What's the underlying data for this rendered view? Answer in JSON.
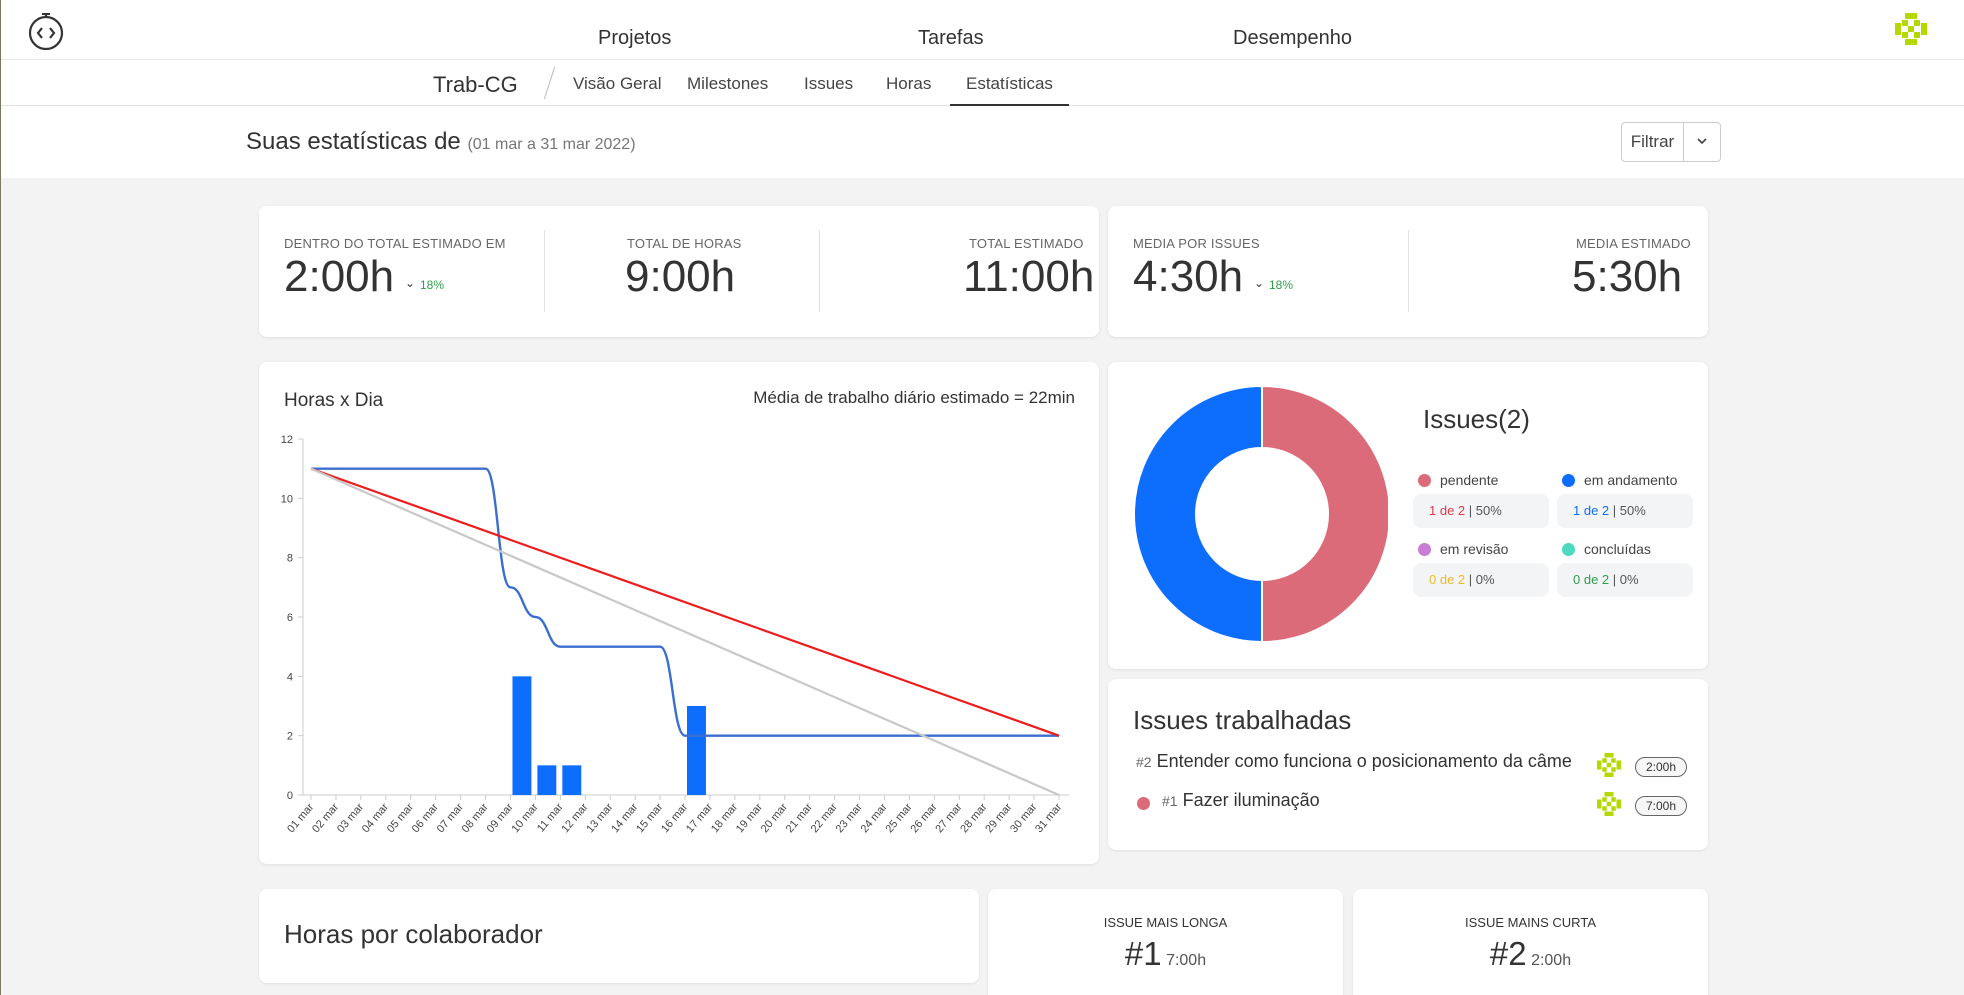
{
  "nav": {
    "items": [
      "Projetos",
      "Tarefas",
      "Desempenho"
    ]
  },
  "project": {
    "name": "Trab-CG",
    "tabs": [
      "Visão Geral",
      "Milestones",
      "Issues",
      "Horas",
      "Estatísticas"
    ],
    "active_tab": "Estatísticas"
  },
  "header": {
    "title": "Suas estatísticas de",
    "range": "(01 mar a 31 mar 2022)",
    "filter_label": "Filtrar"
  },
  "metrics": [
    {
      "label": "DENTRO DO TOTAL ESTIMADO EM",
      "value": "2:00h",
      "delta": "18%"
    },
    {
      "label": "TOTAL DE HORAS",
      "value": "9:00h"
    },
    {
      "label": "TOTAL ESTIMADO",
      "value": "11:00h"
    },
    {
      "label": "MEDIA POR ISSUES",
      "value": "4:30h",
      "delta": "18%"
    },
    {
      "label": "MEDIA ESTIMADO",
      "value": "5:30h"
    }
  ],
  "hours_chart": {
    "title": "Horas x Dia",
    "note": "Média de trabalho diário estimado = 22min"
  },
  "chart_data": [
    {
      "type": "bar",
      "title": "Horas x Dia",
      "categories": [
        "01 mar",
        "02 mar",
        "03 mar",
        "04 mar",
        "05 mar",
        "06 mar",
        "07 mar",
        "08 mar",
        "09 mar",
        "10 mar",
        "11 mar",
        "12 mar",
        "13 mar",
        "14 mar",
        "15 mar",
        "16 mar",
        "17 mar",
        "18 mar",
        "19 mar",
        "20 mar",
        "21 mar",
        "22 mar",
        "23 mar",
        "24 mar",
        "25 mar",
        "26 mar",
        "27 mar",
        "28 mar",
        "29 mar",
        "30 mar",
        "31 mar"
      ],
      "ylim": [
        0,
        12
      ],
      "yticks": [
        0,
        2,
        4,
        6,
        8,
        10,
        12
      ],
      "series": [
        {
          "kind": "bar",
          "color": "#0d6efd",
          "values": [
            0,
            0,
            0,
            0,
            0,
            0,
            0,
            0,
            4,
            1,
            1,
            0,
            0,
            0,
            0,
            3,
            0,
            0,
            0,
            0,
            0,
            0,
            0,
            0,
            0,
            0,
            0,
            0,
            0,
            0,
            0
          ]
        },
        {
          "kind": "line",
          "color": "#3b6fcf",
          "values": [
            11,
            11,
            11,
            11,
            11,
            11,
            11,
            11,
            7,
            6,
            5,
            5,
            5,
            5,
            5,
            2,
            2,
            2,
            2,
            2,
            2,
            2,
            2,
            2,
            2,
            2,
            2,
            2,
            2,
            2,
            2
          ]
        },
        {
          "kind": "line",
          "color": "#ee1c1c",
          "values": [
            11,
            2
          ]
        },
        {
          "kind": "line",
          "color": "#c8c8c8",
          "values": [
            11,
            0
          ]
        }
      ]
    },
    {
      "type": "pie",
      "title": "Issues(2)",
      "categories": [
        "pendente",
        "em andamento",
        "em revisão",
        "concluídas"
      ],
      "values": [
        1,
        1,
        0,
        0
      ],
      "colors": [
        "#dc6b79",
        "#0d6efd",
        "#c77dd6",
        "#4dd9c0"
      ]
    }
  ],
  "issues_chart": {
    "title": "Issues(2)",
    "legend": [
      {
        "label": "pendente",
        "count": "1 de 2",
        "pct": "50%",
        "color": "#dc6b79",
        "count_color": "#e0384b"
      },
      {
        "label": "em andamento",
        "count": "1 de 2",
        "pct": "50%",
        "color": "#0d6efd",
        "count_color": "#0d6efd"
      },
      {
        "label": "em revisão",
        "count": "0 de 2",
        "pct": "0%",
        "color": "#c77dd6",
        "count_color": "#f0b82b"
      },
      {
        "label": "concluídas",
        "count": "0 de 2",
        "pct": "0%",
        "color": "#4dd9c0",
        "count_color": "#2e9e4a"
      }
    ]
  },
  "issues_worked": {
    "title": "Issues trabalhadas",
    "items": [
      {
        "num": "#2",
        "title": "Entender como funciona o posicionamento da câme",
        "time": "2:00h"
      },
      {
        "num": "#1",
        "title": "Fazer iluminação",
        "time": "7:00h",
        "dot_color": "#dc6b79"
      }
    ]
  },
  "collaborators": {
    "title": "Horas por colaborador"
  },
  "longest": {
    "label": "ISSUE MAIS LONGA",
    "num": "#1",
    "time": "7:00h"
  },
  "shortest": {
    "label": "ISSUE MAINS CURTA",
    "num": "#2",
    "time": "2:00h"
  }
}
